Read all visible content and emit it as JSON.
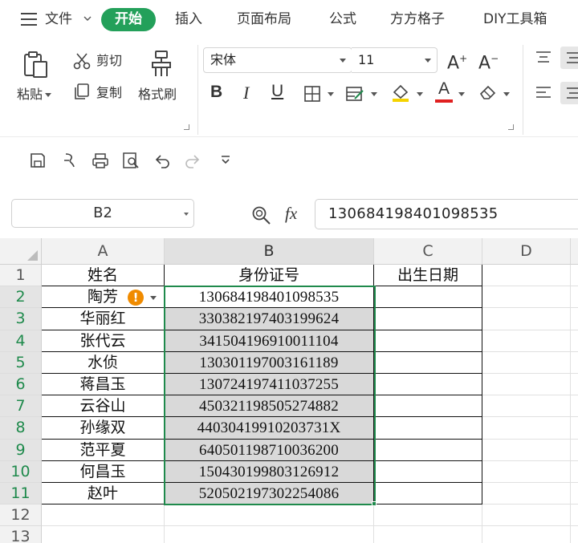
{
  "menubar": {
    "file_label": "文件",
    "tabs": [
      {
        "label": "开始"
      },
      {
        "label": "插入"
      },
      {
        "label": "页面布局"
      },
      {
        "label": "公式"
      },
      {
        "label": "方方格子"
      },
      {
        "label": "DIY工具箱"
      }
    ]
  },
  "ribbon": {
    "paste_label": "粘贴",
    "cut_label": "剪切",
    "copy_label": "复制",
    "format_painter_label": "格式刷",
    "font_name": "宋体",
    "font_size": "11",
    "icons": {
      "bold": "B",
      "italic": "I",
      "underline": "U",
      "font_color_letter": "A",
      "grow_font": "A",
      "shrink_font": "A"
    }
  },
  "formula_bar": {
    "cell_ref": "B2",
    "fx_label": "fx",
    "value": "130684198401098535"
  },
  "grid": {
    "columns": [
      "A",
      "B",
      "C",
      "D"
    ],
    "rows": [
      "1",
      "2",
      "3",
      "4",
      "5",
      "6",
      "7",
      "8",
      "9",
      "10",
      "11",
      "12",
      "13"
    ],
    "headers": {
      "a": "姓名",
      "b": "身份证号",
      "c": "出生日期"
    },
    "records": [
      {
        "name": "陶芳",
        "id": "130684198401098535"
      },
      {
        "name": "华丽红",
        "id": "330382197403199624"
      },
      {
        "name": "张代云",
        "id": "341504196910011104"
      },
      {
        "name": "水侦",
        "id": "130301197003161189"
      },
      {
        "name": "蒋昌玉",
        "id": "130724197411037255"
      },
      {
        "name": "云谷山",
        "id": "450321198505274882"
      },
      {
        "name": "孙缘双",
        "id": "44030419910203731X"
      },
      {
        "name": "范平夏",
        "id": "640501198710036200"
      },
      {
        "name": "何昌玉",
        "id": "150430199803126912"
      },
      {
        "name": "赵叶",
        "id": "520502197302254086"
      }
    ],
    "warning_icon_text": "!"
  },
  "colors": {
    "accent": "#23a05a",
    "selection": "#1f8a4c",
    "warning": "#f08b00",
    "shaded_cell": "#d9d9d9"
  }
}
